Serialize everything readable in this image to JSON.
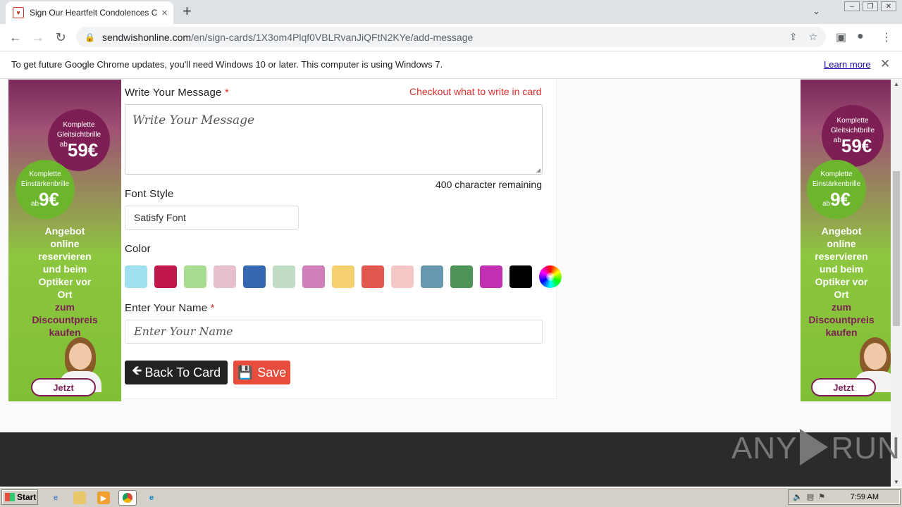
{
  "browser": {
    "tab_title": "Sign Our Heartfelt Condolences Card",
    "tab_close": "×",
    "new_tab": "+",
    "url_host": "sendwishonline.com",
    "url_path": "/en/sign-cards/1X3om4Plqf0VBLRvanJiQFtN2KYe/add-message"
  },
  "infobar": {
    "message": "To get future Google Chrome updates, you'll need Windows 10 or later. This computer is using Windows 7.",
    "learn_more": "Learn more",
    "close": "✕"
  },
  "ad": {
    "bubble1_line1": "Komplette",
    "bubble1_line2": "Gleitsichtbrille",
    "bubble1_ab": "ab",
    "bubble1_price": "59€",
    "bubble2_line1": "Komplette",
    "bubble2_line2": "Einstärkenbrille",
    "bubble2_ab": "ab",
    "bubble2_price": "9€",
    "headline_lines": [
      "Angebot",
      "online",
      "reservieren",
      "und beim",
      "Optiker vor",
      "Ort"
    ],
    "highlight_lines": [
      "zum",
      "Discountpreis",
      "kaufen"
    ],
    "cta": "Jetzt"
  },
  "form": {
    "message_label": "Write Your Message",
    "required_mark": "*",
    "helper_link": "Checkout what to write in card",
    "message_placeholder": "Write Your Message",
    "char_remaining": "400 character remaining",
    "font_style_label": "Font Style",
    "font_style_value": "Satisfy Font",
    "color_label": "Color",
    "colors": [
      "#9ee0ef",
      "#c0184a",
      "#a8dc90",
      "#e8c0cc",
      "#3468b0",
      "#c0dcc4",
      "#d080b8",
      "#f5d070",
      "#e05850",
      "#f5c8c8",
      "#6898b0",
      "#4e9458",
      "#c030b0",
      "#000000"
    ],
    "name_label": "Enter Your Name",
    "name_placeholder": "Enter Your Name",
    "back_button": "Back To Card",
    "save_button": "Save"
  },
  "watermark": {
    "left": "ANY",
    "right": "RUN"
  },
  "taskbar": {
    "start": "Start",
    "clock": "7:59 AM"
  }
}
